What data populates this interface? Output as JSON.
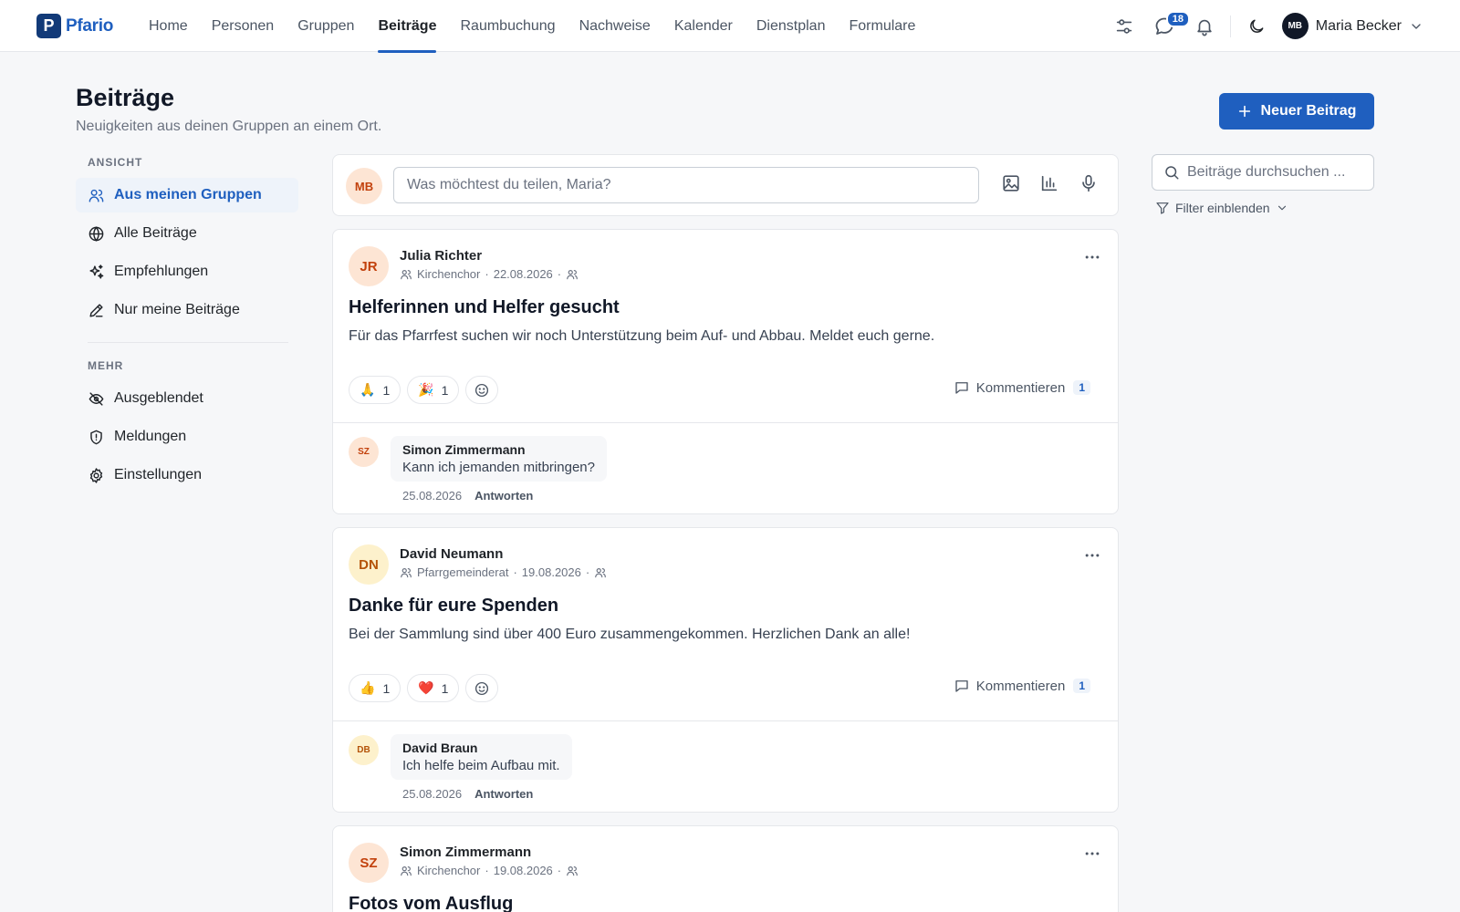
{
  "app": {
    "name": "Pfario",
    "logo_letter": "P"
  },
  "nav": [
    "Home",
    "Personen",
    "Gruppen",
    "Beiträge",
    "Raumbuchung",
    "Nachweise",
    "Kalender",
    "Dienstplan",
    "Formulare"
  ],
  "nav_active": "Beiträge",
  "topbar": {
    "messages_badge": "18",
    "user_initials": "MB",
    "user_name": "Maria Becker"
  },
  "header": {
    "title": "Beiträge",
    "subtitle": "Neuigkeiten aus deinen Gruppen an einem Ort.",
    "new_button": "Neuer Beitrag"
  },
  "sidebar": {
    "view_label": "ANSICHT",
    "view_items": [
      {
        "label": "Aus meinen Gruppen",
        "icon": "users-icon",
        "active": true
      },
      {
        "label": "Alle Beiträge",
        "icon": "globe-icon"
      },
      {
        "label": "Empfehlungen",
        "icon": "sparkles-icon"
      },
      {
        "label": "Nur meine Beiträge",
        "icon": "pencil-icon"
      }
    ],
    "more_label": "MEHR",
    "more_items": [
      {
        "label": "Ausgeblendet",
        "icon": "eye-off-icon"
      },
      {
        "label": "Meldungen",
        "icon": "shield-icon"
      },
      {
        "label": "Einstellungen",
        "icon": "gear-icon"
      }
    ]
  },
  "composer": {
    "avatar": "MB",
    "placeholder": "Was möchtest du teilen, Maria?"
  },
  "search": {
    "placeholder": "Beiträge durchsuchen ...",
    "filter_label": "Filter einblenden"
  },
  "posts": [
    {
      "initials": "JR",
      "avatar_color": "peach",
      "author": "Julia Richter",
      "group": "Kirchenchor",
      "date": "22.08.2026",
      "title": "Helferinnen und Helfer gesucht",
      "body": "Für das Pfarrfest suchen wir noch Unterstützung beim Auf- und Abbau. Meldet euch gerne.",
      "reactions": [
        {
          "emoji": "🙏",
          "count": "1"
        },
        {
          "emoji": "🎉",
          "count": "1"
        }
      ],
      "comment_label": "Kommentieren",
      "comment_count": "1",
      "comment": {
        "initials": "SZ",
        "avatar_color": "peach",
        "author": "Simon Zimmermann",
        "text": "Kann ich jemanden mitbringen?",
        "date": "25.08.2026",
        "reply": "Antworten"
      }
    },
    {
      "initials": "DN",
      "avatar_color": "yellow",
      "author": "David Neumann",
      "group": "Pfarrgemeinderat",
      "date": "19.08.2026",
      "title": "Danke für eure Spenden",
      "body": "Bei der Sammlung sind über 400 Euro zusammengekommen. Herzlichen Dank an alle!",
      "reactions": [
        {
          "emoji": "👍",
          "count": "1"
        },
        {
          "emoji": "❤️",
          "count": "1"
        }
      ],
      "comment_label": "Kommentieren",
      "comment_count": "1",
      "comment": {
        "initials": "DB",
        "avatar_color": "yellow",
        "author": "David Braun",
        "text": "Ich helfe beim Aufbau mit.",
        "date": "25.08.2026",
        "reply": "Antworten"
      }
    },
    {
      "initials": "SZ",
      "avatar_color": "peach",
      "author": "Simon Zimmermann",
      "group": "Kirchenchor",
      "date": "19.08.2026",
      "title": "Fotos vom Ausflug"
    }
  ],
  "colors": {
    "accent": "#1f5fbf",
    "avatar_peach": "#fde5d4",
    "avatar_yellow": "#fdf1cc"
  }
}
